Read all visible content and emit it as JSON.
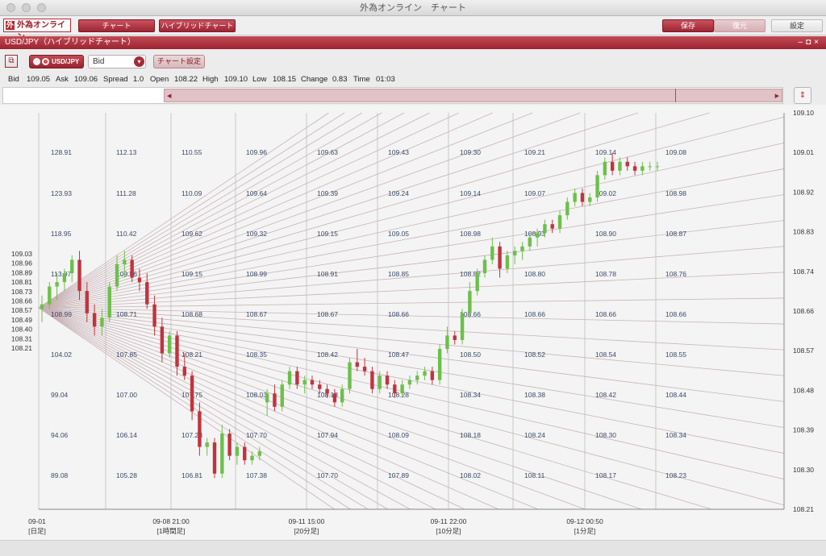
{
  "window": {
    "title": "外為オンライン　チャート"
  },
  "toolbar": {
    "logo_text": "外為オンライン",
    "chart_label": "チャート",
    "hybrid_label": "ハイブリッドチャート",
    "save_label": "保存",
    "restore_label": "復元",
    "settings_label": "設定"
  },
  "panel": {
    "title": "USD/JPY（ハイブリッドチャート）"
  },
  "controls": {
    "pair": "USD/JPY",
    "price_type": "Bid",
    "chart_settings_label": "チャート設定"
  },
  "quote": {
    "bid_label": "Bid",
    "bid": "109.05",
    "ask_label": "Ask",
    "ask": "109.06",
    "spread_label": "Spread",
    "spread": "1.0",
    "open_label": "Open",
    "open": "108.22",
    "high_label": "High",
    "high": "109.10",
    "low_label": "Low",
    "low": "108.15",
    "change_label": "Change",
    "change": "0.83",
    "time_label": "Time",
    "time": "01:03"
  },
  "colors": {
    "accent": "#a32b37",
    "up": "#6cc04a",
    "down": "#c0343e",
    "fan": "#c9b2b6",
    "grid": "#c8c8c8"
  },
  "chart_data": {
    "type": "candlestick",
    "title": "",
    "right_axis": {
      "ticks": [
        "109.10",
        "109.01",
        "108.92",
        "108.83",
        "108.74",
        "108.66",
        "108.57",
        "108.48",
        "108.39",
        "108.30",
        "108.21"
      ],
      "ylim": [
        108.21,
        109.1
      ]
    },
    "left_axis": {
      "ticks": [
        "109.03",
        "108.96",
        "108.89",
        "108.81",
        "108.73",
        "108.66",
        "108.57",
        "108.49",
        "108.40",
        "108.31",
        "108.21"
      ]
    },
    "x_ticks": [
      {
        "date": "09-01",
        "tf": "[日足]"
      },
      {
        "date": "09-08 21:00",
        "tf": "[1時間足]"
      },
      {
        "date": "09-11 15:00",
        "tf": "[20分足]"
      },
      {
        "date": "09-11 22:00",
        "tf": "[10分足]"
      },
      {
        "date": "09-12 00:50",
        "tf": "[1分足]"
      }
    ],
    "level_columns": [
      [
        "128.91",
        "123.93",
        "118.95",
        "113.97",
        "108.99",
        "104.02",
        "99.04",
        "94.06",
        "89.08"
      ],
      [
        "112.13",
        "111.28",
        "110.42",
        "109.56",
        "108.71",
        "107.85",
        "107.00",
        "106.14",
        "105.28"
      ],
      [
        "110.55",
        "110.09",
        "109.62",
        "109.15",
        "108.68",
        "108.21",
        "107.75",
        "107.28",
        "106.81"
      ],
      [
        "109.96",
        "109.64",
        "109.32",
        "108.99",
        "108.67",
        "108.35",
        "108.03",
        "107.70",
        "107.38"
      ],
      [
        "109.63",
        "109.39",
        "109.15",
        "108.91",
        "108.67",
        "108.42",
        "108.18",
        "107.94",
        "107.70"
      ],
      [
        "109.43",
        "109.24",
        "109.05",
        "108.85",
        "108.66",
        "108.47",
        "108.28",
        "108.09",
        "107.89"
      ],
      [
        "109.30",
        "109.14",
        "108.98",
        "108.82",
        "108.66",
        "108.50",
        "108.34",
        "108.18",
        "108.02"
      ],
      [
        "109.21",
        "109.07",
        "108.93",
        "108.80",
        "108.66",
        "108.52",
        "108.38",
        "108.24",
        "108.11"
      ],
      [
        "109.14",
        "109.02",
        "108.90",
        "108.78",
        "108.66",
        "108.54",
        "108.42",
        "108.30",
        "108.17"
      ],
      [
        "109.08",
        "108.98",
        "108.87",
        "108.76",
        "108.66",
        "108.55",
        "108.44",
        "108.34",
        "108.23"
      ]
    ],
    "candles": [
      {
        "o": 108.66,
        "h": 108.69,
        "l": 108.63,
        "c": 108.67
      },
      {
        "o": 108.67,
        "h": 108.72,
        "l": 108.66,
        "c": 108.71
      },
      {
        "o": 108.71,
        "h": 108.74,
        "l": 108.68,
        "c": 108.72
      },
      {
        "o": 108.72,
        "h": 108.75,
        "l": 108.7,
        "c": 108.74
      },
      {
        "o": 108.74,
        "h": 108.78,
        "l": 108.72,
        "c": 108.77
      },
      {
        "o": 108.77,
        "h": 108.79,
        "l": 108.68,
        "c": 108.7
      },
      {
        "o": 108.7,
        "h": 108.72,
        "l": 108.63,
        "c": 108.65
      },
      {
        "o": 108.65,
        "h": 108.67,
        "l": 108.6,
        "c": 108.62
      },
      {
        "o": 108.62,
        "h": 108.66,
        "l": 108.6,
        "c": 108.64
      },
      {
        "o": 108.64,
        "h": 108.72,
        "l": 108.63,
        "c": 108.71
      },
      {
        "o": 108.71,
        "h": 108.78,
        "l": 108.7,
        "c": 108.76
      },
      {
        "o": 108.76,
        "h": 108.79,
        "l": 108.73,
        "c": 108.77
      },
      {
        "o": 108.77,
        "h": 108.78,
        "l": 108.72,
        "c": 108.73
      },
      {
        "o": 108.73,
        "h": 108.75,
        "l": 108.7,
        "c": 108.72
      },
      {
        "o": 108.72,
        "h": 108.74,
        "l": 108.66,
        "c": 108.67
      },
      {
        "o": 108.67,
        "h": 108.69,
        "l": 108.6,
        "c": 108.62
      },
      {
        "o": 108.62,
        "h": 108.64,
        "l": 108.54,
        "c": 108.56
      },
      {
        "o": 108.56,
        "h": 108.61,
        "l": 108.55,
        "c": 108.6
      },
      {
        "o": 108.6,
        "h": 108.61,
        "l": 108.51,
        "c": 108.53
      },
      {
        "o": 108.53,
        "h": 108.56,
        "l": 108.5,
        "c": 108.51
      },
      {
        "o": 108.51,
        "h": 108.52,
        "l": 108.41,
        "c": 108.43
      },
      {
        "o": 108.43,
        "h": 108.45,
        "l": 108.33,
        "c": 108.35
      },
      {
        "o": 108.35,
        "h": 108.37,
        "l": 108.33,
        "c": 108.36
      },
      {
        "o": 108.36,
        "h": 108.37,
        "l": 108.28,
        "c": 108.29
      },
      {
        "o": 108.29,
        "h": 108.4,
        "l": 108.28,
        "c": 108.38
      },
      {
        "o": 108.38,
        "h": 108.39,
        "l": 108.32,
        "c": 108.33
      },
      {
        "o": 108.33,
        "h": 108.36,
        "l": 108.31,
        "c": 108.35
      },
      {
        "o": 108.35,
        "h": 108.36,
        "l": 108.31,
        "c": 108.32
      },
      {
        "o": 108.32,
        "h": 108.34,
        "l": 108.31,
        "c": 108.33
      },
      {
        "o": 108.33,
        "h": 108.35,
        "l": 108.32,
        "c": 108.34
      },
      {
        "o": 108.45,
        "h": 108.48,
        "l": 108.42,
        "c": 108.47
      },
      {
        "o": 108.47,
        "h": 108.49,
        "l": 108.43,
        "c": 108.44
      },
      {
        "o": 108.44,
        "h": 108.5,
        "l": 108.43,
        "c": 108.49
      },
      {
        "o": 108.49,
        "h": 108.53,
        "l": 108.48,
        "c": 108.52
      },
      {
        "o": 108.52,
        "h": 108.53,
        "l": 108.48,
        "c": 108.49
      },
      {
        "o": 108.49,
        "h": 108.51,
        "l": 108.47,
        "c": 108.5
      },
      {
        "o": 108.5,
        "h": 108.51,
        "l": 108.48,
        "c": 108.49
      },
      {
        "o": 108.49,
        "h": 108.5,
        "l": 108.47,
        "c": 108.48
      },
      {
        "o": 108.48,
        "h": 108.49,
        "l": 108.46,
        "c": 108.47
      },
      {
        "o": 108.47,
        "h": 108.48,
        "l": 108.44,
        "c": 108.45
      },
      {
        "o": 108.45,
        "h": 108.49,
        "l": 108.44,
        "c": 108.48
      },
      {
        "o": 108.48,
        "h": 108.55,
        "l": 108.47,
        "c": 108.54
      },
      {
        "o": 108.54,
        "h": 108.57,
        "l": 108.52,
        "c": 108.53
      },
      {
        "o": 108.53,
        "h": 108.55,
        "l": 108.51,
        "c": 108.52
      },
      {
        "o": 108.52,
        "h": 108.53,
        "l": 108.47,
        "c": 108.48
      },
      {
        "o": 108.48,
        "h": 108.52,
        "l": 108.47,
        "c": 108.51
      },
      {
        "o": 108.51,
        "h": 108.52,
        "l": 108.48,
        "c": 108.49
      },
      {
        "o": 108.49,
        "h": 108.5,
        "l": 108.46,
        "c": 108.47
      },
      {
        "o": 108.47,
        "h": 108.5,
        "l": 108.46,
        "c": 108.49
      },
      {
        "o": 108.49,
        "h": 108.51,
        "l": 108.48,
        "c": 108.5
      },
      {
        "o": 108.5,
        "h": 108.52,
        "l": 108.49,
        "c": 108.51
      },
      {
        "o": 108.51,
        "h": 108.53,
        "l": 108.5,
        "c": 108.52
      },
      {
        "o": 108.52,
        "h": 108.53,
        "l": 108.49,
        "c": 108.5
      },
      {
        "o": 108.5,
        "h": 108.58,
        "l": 108.49,
        "c": 108.57
      },
      {
        "o": 108.57,
        "h": 108.62,
        "l": 108.56,
        "c": 108.6
      },
      {
        "o": 108.6,
        "h": 108.61,
        "l": 108.58,
        "c": 108.59
      },
      {
        "o": 108.59,
        "h": 108.66,
        "l": 108.58,
        "c": 108.65
      },
      {
        "o": 108.65,
        "h": 108.72,
        "l": 108.64,
        "c": 108.7
      },
      {
        "o": 108.7,
        "h": 108.75,
        "l": 108.69,
        "c": 108.74
      },
      {
        "o": 108.74,
        "h": 108.78,
        "l": 108.73,
        "c": 108.77
      },
      {
        "o": 108.77,
        "h": 108.82,
        "l": 108.76,
        "c": 108.8
      },
      {
        "o": 108.8,
        "h": 108.81,
        "l": 108.73,
        "c": 108.75
      },
      {
        "o": 108.75,
        "h": 108.79,
        "l": 108.74,
        "c": 108.78
      },
      {
        "o": 108.78,
        "h": 108.8,
        "l": 108.76,
        "c": 108.79
      },
      {
        "o": 108.79,
        "h": 108.81,
        "l": 108.77,
        "c": 108.8
      },
      {
        "o": 108.8,
        "h": 108.83,
        "l": 108.79,
        "c": 108.82
      },
      {
        "o": 108.82,
        "h": 108.84,
        "l": 108.8,
        "c": 108.83
      },
      {
        "o": 108.83,
        "h": 108.86,
        "l": 108.82,
        "c": 108.85
      },
      {
        "o": 108.85,
        "h": 108.86,
        "l": 108.83,
        "c": 108.84
      },
      {
        "o": 108.84,
        "h": 108.88,
        "l": 108.83,
        "c": 108.87
      },
      {
        "o": 108.87,
        "h": 108.91,
        "l": 108.86,
        "c": 108.9
      },
      {
        "o": 108.9,
        "h": 108.93,
        "l": 108.89,
        "c": 108.92
      },
      {
        "o": 108.92,
        "h": 108.93,
        "l": 108.89,
        "c": 108.9
      },
      {
        "o": 108.9,
        "h": 108.92,
        "l": 108.89,
        "c": 108.91
      },
      {
        "o": 108.91,
        "h": 108.97,
        "l": 108.9,
        "c": 108.96
      },
      {
        "o": 108.96,
        "h": 109.0,
        "l": 108.95,
        "c": 108.99
      },
      {
        "o": 108.99,
        "h": 109.01,
        "l": 108.96,
        "c": 108.97
      },
      {
        "o": 108.97,
        "h": 109.0,
        "l": 108.96,
        "c": 108.99
      },
      {
        "o": 108.99,
        "h": 109.0,
        "l": 108.97,
        "c": 108.98
      },
      {
        "o": 108.98,
        "h": 108.99,
        "l": 108.96,
        "c": 108.97
      },
      {
        "o": 108.97,
        "h": 108.99,
        "l": 108.96,
        "c": 108.98
      },
      {
        "o": 108.98,
        "h": 108.99,
        "l": 108.97,
        "c": 108.98
      },
      {
        "o": 108.98,
        "h": 108.99,
        "l": 108.97,
        "c": 108.98
      }
    ]
  }
}
